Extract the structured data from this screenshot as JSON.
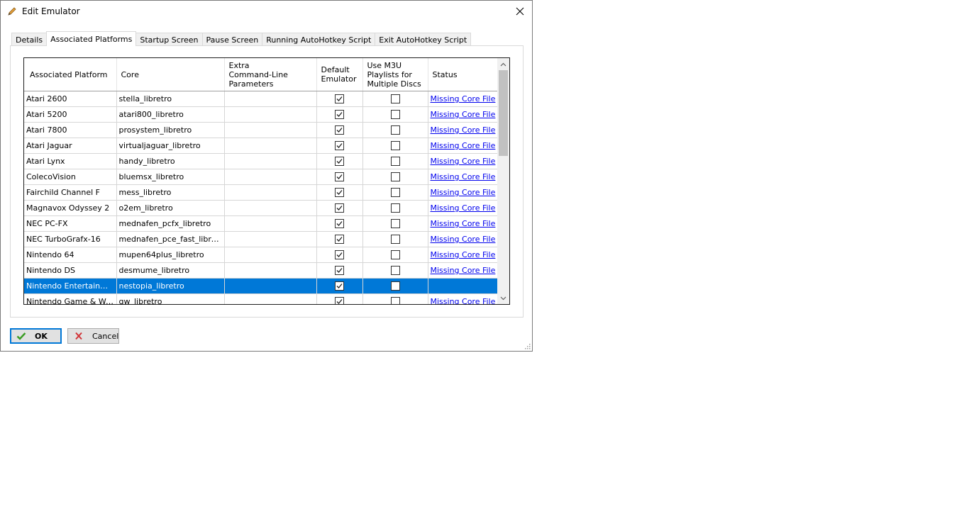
{
  "window": {
    "title": "Edit Emulator"
  },
  "tabs": [
    {
      "label": "Details",
      "active": false
    },
    {
      "label": "Associated Platforms",
      "active": true
    },
    {
      "label": "Startup Screen",
      "active": false
    },
    {
      "label": "Pause Screen",
      "active": false
    },
    {
      "label": "Running AutoHotkey Script",
      "active": false
    },
    {
      "label": "Exit AutoHotkey Script",
      "active": false
    }
  ],
  "grid": {
    "columns": {
      "platform": "Associated Platform",
      "core": "Core",
      "extra": "Extra\nCommand-Line\nParameters",
      "default": "Default\nEmulator",
      "m3u": "Use M3U\nPlaylists for\nMultiple Discs",
      "status": "Status"
    },
    "rows": [
      {
        "platform": "Atari 2600",
        "core": "stella_libretro",
        "extra": "",
        "default": true,
        "m3u": false,
        "status": "Missing Core File",
        "selected": false
      },
      {
        "platform": "Atari 5200",
        "core": "atari800_libretro",
        "extra": "",
        "default": true,
        "m3u": false,
        "status": "Missing Core File",
        "selected": false
      },
      {
        "platform": "Atari 7800",
        "core": "prosystem_libretro",
        "extra": "",
        "default": true,
        "m3u": false,
        "status": "Missing Core File",
        "selected": false
      },
      {
        "platform": "Atari Jaguar",
        "core": "virtualjaguar_libretro",
        "extra": "",
        "default": true,
        "m3u": false,
        "status": "Missing Core File",
        "selected": false
      },
      {
        "platform": "Atari Lynx",
        "core": "handy_libretro",
        "extra": "",
        "default": true,
        "m3u": false,
        "status": "Missing Core File",
        "selected": false
      },
      {
        "platform": "ColecoVision",
        "core": "bluemsx_libretro",
        "extra": "",
        "default": true,
        "m3u": false,
        "status": "Missing Core File",
        "selected": false
      },
      {
        "platform": "Fairchild Channel F",
        "core": "mess_libretro",
        "extra": "",
        "default": true,
        "m3u": false,
        "status": "Missing Core File",
        "selected": false
      },
      {
        "platform": "Magnavox Odyssey 2",
        "core": "o2em_libretro",
        "extra": "",
        "default": true,
        "m3u": false,
        "status": "Missing Core File",
        "selected": false
      },
      {
        "platform": "NEC PC-FX",
        "core": "mednafen_pcfx_libretro",
        "extra": "",
        "default": true,
        "m3u": false,
        "status": "Missing Core File",
        "selected": false
      },
      {
        "platform": "NEC TurboGrafx-16",
        "core": "mednafen_pce_fast_libretro",
        "extra": "",
        "default": true,
        "m3u": false,
        "status": "Missing Core File",
        "selected": false
      },
      {
        "platform": "Nintendo 64",
        "core": "mupen64plus_libretro",
        "extra": "",
        "default": true,
        "m3u": false,
        "status": "Missing Core File",
        "selected": false
      },
      {
        "platform": "Nintendo DS",
        "core": "desmume_libretro",
        "extra": "",
        "default": true,
        "m3u": false,
        "status": "Missing Core File",
        "selected": false
      },
      {
        "platform": "Nintendo Entertainmen…",
        "core": "nestopia_libretro",
        "extra": "",
        "default": true,
        "m3u": false,
        "status": "",
        "selected": true
      },
      {
        "platform": "Nintendo Game & Watch",
        "core": "gw_libretro",
        "extra": "",
        "default": true,
        "m3u": false,
        "status": "Missing Core File",
        "selected": false
      }
    ]
  },
  "buttons": {
    "ok": "OK",
    "cancel": "Cancel"
  },
  "colors": {
    "selection": "#0078d7",
    "link": "#0000ee",
    "ok_icon": "#3a9d23",
    "cancel_icon": "#d13438"
  },
  "icons": {
    "title": "pencil-icon",
    "close": "close-icon",
    "ok": "checkmark-icon",
    "cancel": "x-icon"
  }
}
